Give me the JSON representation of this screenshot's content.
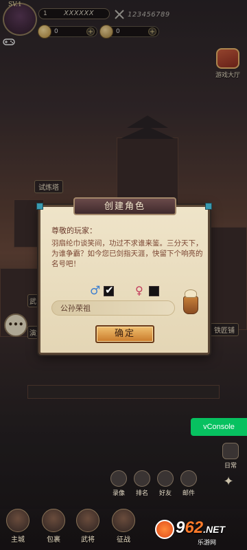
{
  "hud": {
    "vip": "SV.1",
    "level": "1",
    "player_name": "XXXXXX",
    "power": "123456789",
    "resource_1": "0",
    "resource_2": "0",
    "plus": "+"
  },
  "side": {
    "game_hall": "游戏大厅",
    "daily": "日常",
    "chat_glyph": "•••"
  },
  "map": {
    "label_trial": "试炼塔",
    "label_smith": "铁匠铺",
    "label_left_1": "武",
    "label_left_2": "演武"
  },
  "dialog": {
    "title": "创建角色",
    "greeting": "尊敬的玩家：",
    "intro": "羽扇纶巾谈笑间，功过不求谁来鉴。三分天下，为谁争霸？如今您已剑指天涯，快留下个响亮的名号吧！",
    "male_symbol": "♂",
    "female_symbol": "♀",
    "check": "✔",
    "name_value": "公孙荣祖",
    "confirm": "确定"
  },
  "vconsole": "vConsole",
  "mid_menu": [
    {
      "label": "录像"
    },
    {
      "label": "排名"
    },
    {
      "label": "好友"
    },
    {
      "label": "邮件"
    }
  ],
  "bottom_nav": [
    {
      "label": "主城"
    },
    {
      "label": "包裹"
    },
    {
      "label": "武将"
    },
    {
      "label": "征战"
    }
  ],
  "watermark": {
    "brand_a": "9",
    "brand_b": "62",
    "brand_c": ".NET",
    "sub": "乐游网"
  },
  "colors": {
    "male": "#3d7fcf",
    "female": "#c23b5c",
    "vconsole": "#07c160",
    "confirm": "#e4a04e"
  }
}
